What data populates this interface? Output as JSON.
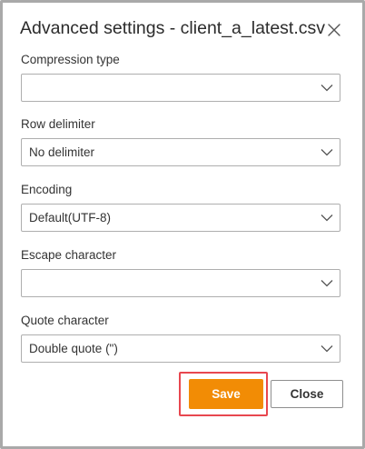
{
  "dialog": {
    "title": "Advanced settings - client_a_latest.csv",
    "close_icon": "close-icon"
  },
  "fields": [
    {
      "label": "Compression type",
      "value": ""
    },
    {
      "label": "Row delimiter",
      "value": "No delimiter"
    },
    {
      "label": "Encoding",
      "value": "Default(UTF-8)"
    },
    {
      "label": "Escape character",
      "value": ""
    },
    {
      "label": "Quote character",
      "value": "Double quote (\")"
    }
  ],
  "buttons": {
    "save_label": "Save",
    "close_label": "Close"
  },
  "colors": {
    "save_background": "#f28c05",
    "highlight_border": "#e8474f",
    "dialog_border": "#a9a9a9"
  },
  "icons": {
    "dropdown": "chevron-down-icon"
  }
}
